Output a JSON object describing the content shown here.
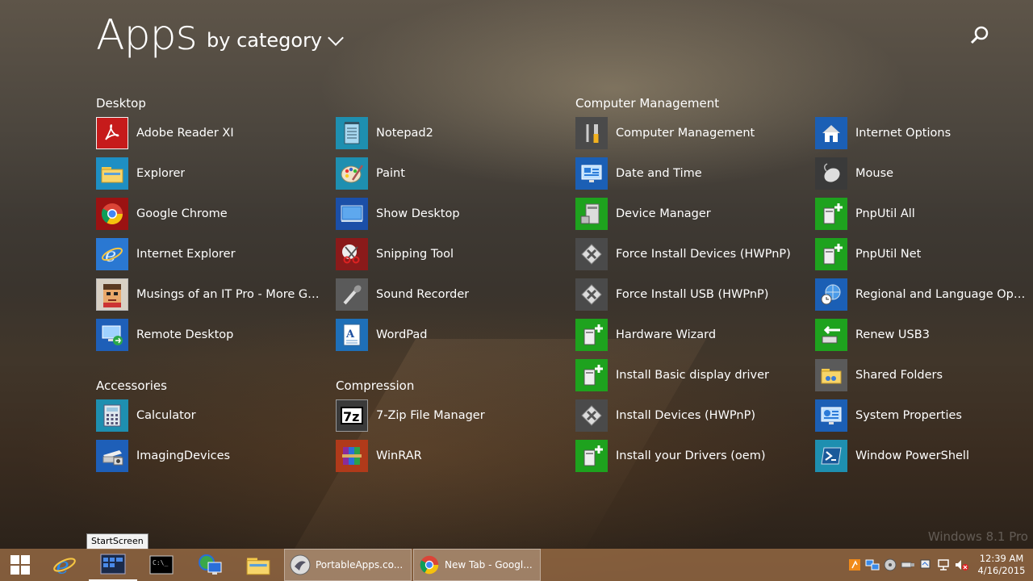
{
  "header": {
    "title": "Apps",
    "sort_label": "by category"
  },
  "groups": {
    "desktop": "Desktop",
    "accessories": "Accessories",
    "compression": "Compression",
    "computer_management": "Computer Management"
  },
  "apps": {
    "col1": [
      "Adobe Reader XI",
      "Explorer",
      "Google Chrome",
      "Internet Explorer",
      "Musings of an IT Pro - More Gan...",
      "Remote Desktop"
    ],
    "col1b": [
      "Calculator",
      "ImagingDevices"
    ],
    "col2": [
      "Notepad2",
      "Paint",
      "Show Desktop",
      "Snipping Tool",
      "Sound Recorder",
      "WordPad"
    ],
    "col2b": [
      "7-Zip File Manager",
      "WinRAR"
    ],
    "col3": [
      "Computer Management",
      "Date and Time",
      "Device Manager",
      "Force Install Devices (HWPnP)",
      "Force Install USB (HWPnP)",
      "Hardware Wizard",
      "Install Basic display driver",
      "Install Devices (HWPnP)",
      "Install your Drivers (oem)"
    ],
    "col4": [
      "Internet Options",
      "Mouse",
      "PnpUtil All",
      "PnpUtil Net",
      "Regional and Language Options",
      "Renew USB3",
      "Shared Folders",
      "System Properties",
      "Window PowerShell"
    ]
  },
  "watermark": "Windows 8.1 Pro",
  "tooltip": "StartScreen",
  "taskbar": {
    "tasks": [
      "PortableApps.co...",
      "New Tab - Googl..."
    ],
    "time": "12:39 AM",
    "date": "4/16/2015"
  },
  "colors": {
    "taskbar": "#9c6e46",
    "green_tile": "#1ea21e",
    "blue_tile": "#1b5fb5"
  }
}
